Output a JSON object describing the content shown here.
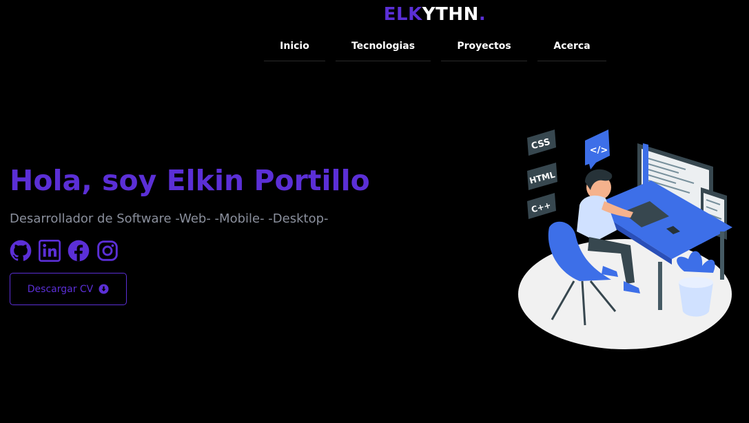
{
  "brand": {
    "logo_part1": "ELK",
    "logo_part2": "YTHN",
    "logo_dot": ".",
    "accent": "#5b2fd6"
  },
  "nav": {
    "items": [
      {
        "label": "Inicio"
      },
      {
        "label": "Tecnologias"
      },
      {
        "label": "Proyectos"
      },
      {
        "label": "Acerca"
      }
    ]
  },
  "hero": {
    "title": "Hola, soy Elkin Portillo",
    "subtitle": "Desarrollador de Software -Web- -Mobile- -Desktop-",
    "cv_button_label": "Descargar CV",
    "socials": [
      {
        "icon": "github-icon"
      },
      {
        "icon": "linkedin-icon"
      },
      {
        "icon": "facebook-icon"
      },
      {
        "icon": "instagram-icon"
      }
    ],
    "illustration": {
      "tags": [
        "CSS",
        "HTML",
        "C++",
        "</>"
      ]
    }
  }
}
